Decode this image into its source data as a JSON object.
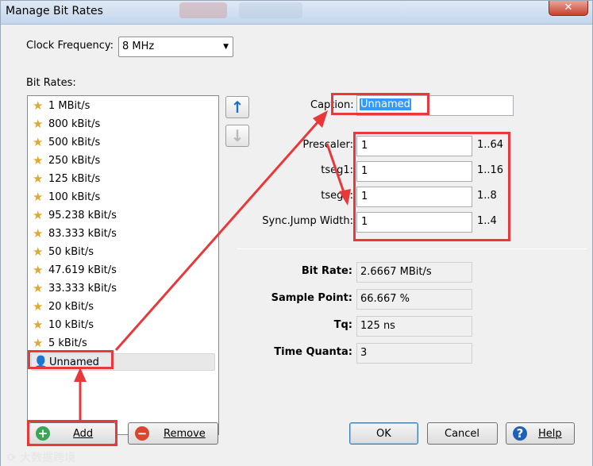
{
  "window": {
    "title": "Manage Bit Rates",
    "close_label": "✕"
  },
  "clock": {
    "label": "Clock Frequency:",
    "value": "8 MHz"
  },
  "bitrates": {
    "label": "Bit Rates:",
    "items": [
      {
        "label": "1 MBit/s",
        "icon": "star-icon"
      },
      {
        "label": "800 kBit/s",
        "icon": "star-icon"
      },
      {
        "label": "500 kBit/s",
        "icon": "star-icon"
      },
      {
        "label": "250 kBit/s",
        "icon": "star-icon"
      },
      {
        "label": "125 kBit/s",
        "icon": "star-icon"
      },
      {
        "label": "100 kBit/s",
        "icon": "star-icon"
      },
      {
        "label": "95.238 kBit/s",
        "icon": "star-icon"
      },
      {
        "label": "83.333 kBit/s",
        "icon": "star-icon"
      },
      {
        "label": "50 kBit/s",
        "icon": "star-icon"
      },
      {
        "label": "47.619 kBit/s",
        "icon": "star-icon"
      },
      {
        "label": "33.333 kBit/s",
        "icon": "star-icon"
      },
      {
        "label": "20 kBit/s",
        "icon": "star-icon"
      },
      {
        "label": "10 kBit/s",
        "icon": "star-icon"
      },
      {
        "label": "5 kBit/s",
        "icon": "star-icon"
      },
      {
        "label": "Unnamed",
        "icon": "user-icon",
        "selected": true
      }
    ]
  },
  "caption": {
    "label": "Caption:",
    "value": "Unnamed"
  },
  "params": [
    {
      "label": "Prescaler:",
      "value": "1",
      "range": "1..64"
    },
    {
      "label": "tseg1:",
      "value": "1",
      "range": "1..16"
    },
    {
      "label": "tseg2:",
      "value": "1",
      "range": "1..8"
    },
    {
      "label": "Sync.Jump Width:",
      "value": "1",
      "range": "1..4"
    }
  ],
  "results": [
    {
      "label": "Bit Rate:",
      "value": "2.6667 MBit/s"
    },
    {
      "label": "Sample Point:",
      "value": "66.667 %"
    },
    {
      "label": "Tq:",
      "value": "125 ns"
    },
    {
      "label": "Time Quanta:",
      "value": "3"
    }
  ],
  "buttons": {
    "add": "Add",
    "remove": "Remove",
    "ok": "OK",
    "cancel": "Cancel",
    "help": "Help"
  },
  "watermark": "大数据跨境",
  "colors": {
    "annotation_red": "#e8383a",
    "star": "#e0a82e",
    "add_green": "#3aa655",
    "remove_red": "#d9452f",
    "help_blue": "#1f5fb5"
  }
}
